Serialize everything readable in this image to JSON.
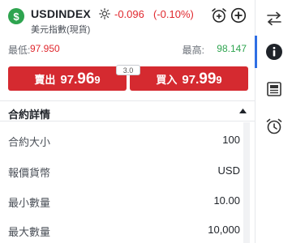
{
  "instrument": {
    "symbol": "USDINDEX",
    "change": "-0.096",
    "change_pct": "(-0.10%)",
    "subtitle": "美元指數(現貨)",
    "badge_glyph": "$",
    "badge_color": "#2ea44f",
    "status_icon": "sun-icon"
  },
  "header_actions": [
    {
      "icon": "alarm-add-icon"
    },
    {
      "icon": "plus-circle-icon"
    }
  ],
  "range": {
    "low_label": "最低:",
    "low_value": "97.950",
    "high_label": "最高:",
    "high_value": "98.147"
  },
  "trade": {
    "spread": "3.0",
    "sell": {
      "label": "賣出",
      "pre": "97.",
      "big": "96",
      "post": "9"
    },
    "buy": {
      "label": "買入",
      "pre": "97.",
      "big": "99",
      "post": "9"
    },
    "button_color": "#d52a30"
  },
  "contract": {
    "title": "合約詳情",
    "rows": [
      {
        "label": "合約大小",
        "value": "100"
      },
      {
        "label": "報價貨幣",
        "value": "USD"
      },
      {
        "label": "最小數量",
        "value": "10.00"
      },
      {
        "label": "最大數量",
        "value": "10,000"
      }
    ]
  },
  "sidebar": {
    "items": [
      {
        "icon": "swap-arrows-icon",
        "active": false
      },
      {
        "icon": "info-icon",
        "active": true
      },
      {
        "icon": "newspaper-icon",
        "active": false
      },
      {
        "icon": "alarm-clock-icon",
        "active": false
      }
    ],
    "accent": "#2f6fe4"
  },
  "colors": {
    "down": "#e0282e",
    "up": "#2ea44f"
  }
}
